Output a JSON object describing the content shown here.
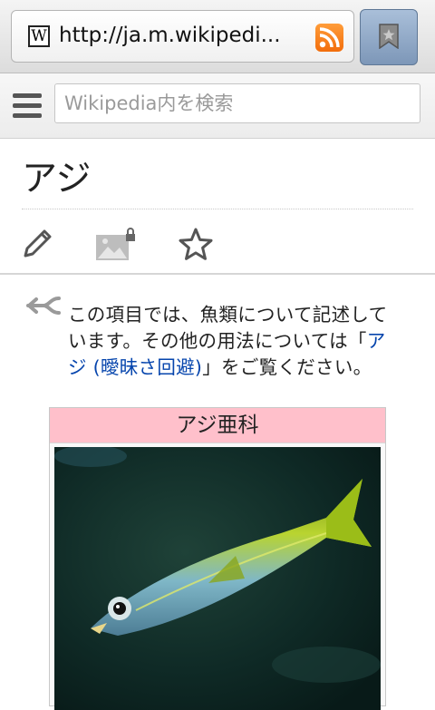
{
  "browser": {
    "url": "http://ja.m.wikipedi...",
    "favicon_letter": "W",
    "icons": [
      "rss-icon",
      "bookmark-icon"
    ]
  },
  "header": {
    "search_placeholder": "Wikipedia内を検索",
    "icons": [
      "menu-icon"
    ]
  },
  "page": {
    "title": "アジ",
    "actions": [
      "edit-icon",
      "image-locked-icon",
      "watch-star-icon"
    ]
  },
  "hatnote": {
    "text_before": "この項目では、魚類について記述しています。その他の用法については「",
    "link_text": "アジ (曖昧さ回避)",
    "text_after": "」をご覧ください。",
    "link_color": "#0645ad"
  },
  "infobox": {
    "title": "アジ亜科",
    "title_bg": "#ffc0cb",
    "image": "horse-mackerel-photo"
  }
}
